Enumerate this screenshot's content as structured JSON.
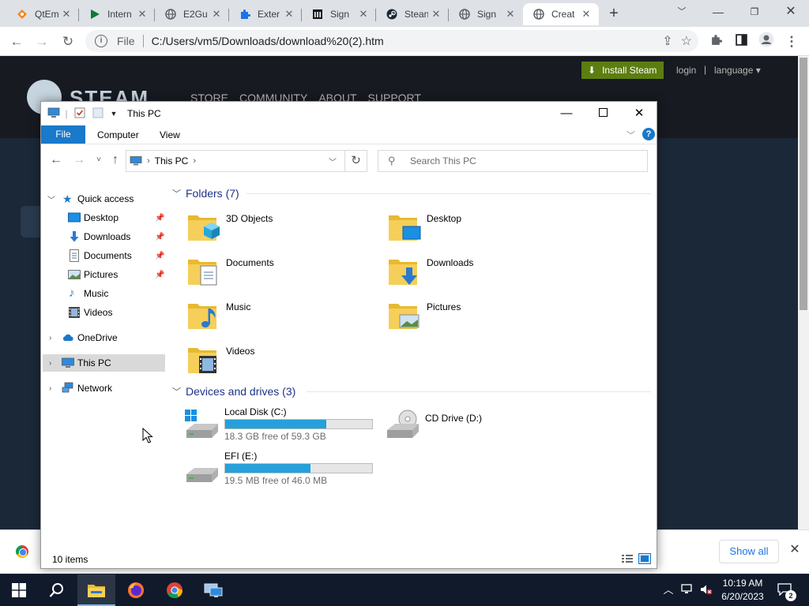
{
  "browser": {
    "tabs": [
      {
        "title": "QtEm",
        "icon": "qt-diamond-icon"
      },
      {
        "title": "Intern",
        "icon": "play-icon"
      },
      {
        "title": "E2Gu",
        "icon": "globe-icon"
      },
      {
        "title": "Exter",
        "icon": "puzzle-icon"
      },
      {
        "title": "Sign",
        "icon": "bank-icon"
      },
      {
        "title": "Stean",
        "icon": "steam-icon"
      },
      {
        "title": "Sign",
        "icon": "globe-icon"
      },
      {
        "title": "Creat",
        "icon": "globe-icon"
      }
    ],
    "new_tab_glyph": "+",
    "address": {
      "scheme_label": "File",
      "url": "C:/Users/vm5/Downloads/download%20(2).htm"
    }
  },
  "steam": {
    "install_label": "Install Steam",
    "login_label": "login",
    "separator": "|",
    "language_label": "language",
    "logo_text": "STEAM",
    "nav": [
      "STORE",
      "COMMUNITY",
      "ABOUT",
      "SUPPORT"
    ]
  },
  "download_bar": {
    "show_all_label": "Show all"
  },
  "explorer": {
    "title": "This PC",
    "ribbon": {
      "file_label": "File",
      "tabs": [
        "Computer",
        "View"
      ]
    },
    "breadcrumb": "This PC",
    "search_placeholder": "Search This PC",
    "nav_pane": {
      "quick_access_label": "Quick access",
      "quick_items": [
        {
          "label": "Desktop",
          "pinned": true
        },
        {
          "label": "Downloads",
          "pinned": true
        },
        {
          "label": "Documents",
          "pinned": true
        },
        {
          "label": "Pictures",
          "pinned": true
        },
        {
          "label": "Music",
          "pinned": false
        },
        {
          "label": "Videos",
          "pinned": false
        }
      ],
      "onedrive_label": "OneDrive",
      "thispc_label": "This PC",
      "network_label": "Network"
    },
    "folders_header": "Folders (7)",
    "folders": [
      "3D Objects",
      "Desktop",
      "Documents",
      "Downloads",
      "Music",
      "Pictures",
      "Videos"
    ],
    "drives_header": "Devices and drives (3)",
    "drives": [
      {
        "name": "Local Disk (C:)",
        "free_text": "18.3 GB free of 59.3 GB",
        "used_fraction": 0.69
      },
      {
        "name": "CD Drive (D:)"
      },
      {
        "name": "EFI (E:)",
        "free_text": "19.5 MB free of 46.0 MB",
        "used_fraction": 0.58
      }
    ],
    "status_text": "10 items"
  },
  "taskbar": {
    "apps": [
      "file-explorer-icon",
      "firefox-icon",
      "chrome-icon",
      "remote-desktop-icon"
    ],
    "time": "10:19 AM",
    "date": "6/20/2023",
    "notification_count": "2"
  },
  "colors": {
    "steam_green": "#5c7e10",
    "explorer_blue": "#1979ca",
    "drive_bar": "#26a0da",
    "taskbar": "#101a2b"
  }
}
